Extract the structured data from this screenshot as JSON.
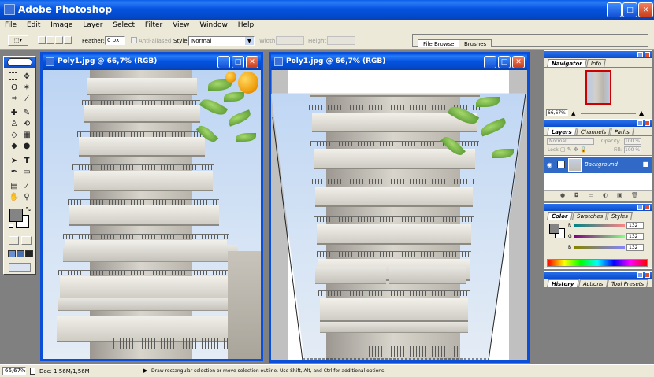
{
  "app": {
    "title": "Adobe Photoshop"
  },
  "menu": [
    "File",
    "Edit",
    "Image",
    "Layer",
    "Select",
    "Filter",
    "View",
    "Window",
    "Help"
  ],
  "options": {
    "feather_label": "Feather:",
    "feather_value": "0 px",
    "antialiased_label": "Anti-aliased",
    "style_label": "Style:",
    "style_value": "Normal",
    "width_label": "Width:",
    "height_label": "Height:"
  },
  "well_tabs": [
    "File Browser",
    "Brushes"
  ],
  "documents": [
    {
      "title": "Poly1.jpg @ 66,7% (RGB)"
    },
    {
      "title": "Poly1.jpg @ 66,7% (RGB)"
    }
  ],
  "navigator": {
    "tabs": [
      "Navigator",
      "Info"
    ],
    "zoom": "66,67%"
  },
  "layers": {
    "tabs": [
      "Layers",
      "Channels",
      "Paths"
    ],
    "blend_mode": "Normal",
    "opacity_label": "Opacity:",
    "opacity_value": "100 %",
    "lock_label": "Lock:",
    "fill_label": "Fill:",
    "fill_value": "100 %",
    "layer_name": "Background"
  },
  "color": {
    "tabs": [
      "Color",
      "Swatches",
      "Styles"
    ],
    "r_label": "R",
    "g_label": "G",
    "b_label": "B",
    "r": "132",
    "g": "132",
    "b": "132",
    "foreground": "#848484"
  },
  "history": {
    "tabs": [
      "History",
      "Actions",
      "Tool Presets"
    ]
  },
  "status": {
    "zoom": "66,67%",
    "doc": "Doc: 1,56M/1,56M",
    "hint": "Draw rectangular selection or move selection outline. Use Shift, Alt, and Ctrl for additional options."
  },
  "colors": {
    "accent": "#0a4ccc",
    "workspace": "#808080",
    "chrome": "#ece9d8"
  }
}
